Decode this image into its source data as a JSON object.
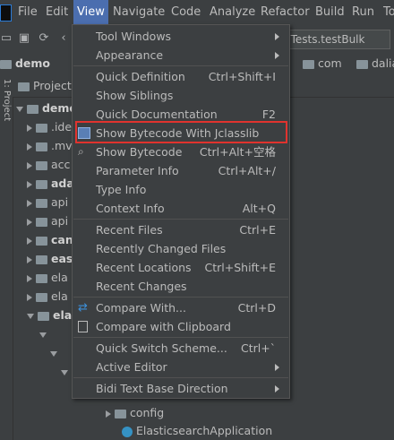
{
  "menubar": {
    "items": [
      "File",
      "Edit",
      "View",
      "Navigate",
      "Code",
      "Analyze",
      "Refactor",
      "Build",
      "Run",
      "To"
    ],
    "active": "View"
  },
  "toolbar": {
    "run_config": "nTests.testBulk"
  },
  "navbar": {
    "project": "demo",
    "crumb1": "com",
    "crumb2": "dalia"
  },
  "project_panel": {
    "title": "Project",
    "left_strip_text": "1: Project",
    "tree": [
      "demo",
      ".ide",
      ".mv",
      "acc",
      "ada",
      "api",
      "api",
      "can",
      "eas",
      "ela",
      "ela",
      "ela"
    ],
    "bottom_items": [
      "config",
      "ElasticsearchApplication"
    ]
  },
  "menu": {
    "groups": [
      [
        {
          "label": "Tool Windows",
          "shortcut": "",
          "submenu": true
        },
        {
          "label": "Appearance",
          "shortcut": "",
          "submenu": true
        }
      ],
      [
        {
          "label": "Quick Definition",
          "shortcut": "Ctrl+Shift+I",
          "submenu": false
        },
        {
          "label": "Show Siblings",
          "shortcut": "",
          "submenu": false
        },
        {
          "label": "Quick Documentation",
          "shortcut": "F2",
          "submenu": false
        },
        {
          "label": "Show Bytecode With Jclasslib",
          "shortcut": "",
          "submenu": false
        },
        {
          "label": "Show Bytecode",
          "shortcut": "Ctrl+Alt+空格",
          "submenu": false
        },
        {
          "label": "Parameter Info",
          "shortcut": "Ctrl+Alt+/",
          "submenu": false
        },
        {
          "label": "Type Info",
          "shortcut": "",
          "submenu": false
        },
        {
          "label": "Context Info",
          "shortcut": "Alt+Q",
          "submenu": false
        }
      ],
      [
        {
          "label": "Recent Files",
          "shortcut": "Ctrl+E",
          "submenu": false
        },
        {
          "label": "Recently Changed Files",
          "shortcut": "",
          "submenu": false
        },
        {
          "label": "Recent Locations",
          "shortcut": "Ctrl+Shift+E",
          "submenu": false
        },
        {
          "label": "Recent Changes",
          "shortcut": "",
          "submenu": false
        }
      ],
      [
        {
          "label": "Compare With...",
          "shortcut": "Ctrl+D",
          "submenu": false
        },
        {
          "label": "Compare with Clipboard",
          "shortcut": "",
          "submenu": false
        }
      ],
      [
        {
          "label": "Quick Switch Scheme...",
          "shortcut": "Ctrl+`",
          "submenu": false
        },
        {
          "label": "Active Editor",
          "shortcut": "",
          "submenu": true
        }
      ],
      [
        {
          "label": "Bidi Text Base Direction",
          "shortcut": "",
          "submenu": true
        }
      ]
    ]
  },
  "colors": {
    "background": "#3c3f41",
    "menu_active": "#4b6eaf",
    "highlight_border": "#e0332e",
    "text": "#bbbbbb"
  }
}
